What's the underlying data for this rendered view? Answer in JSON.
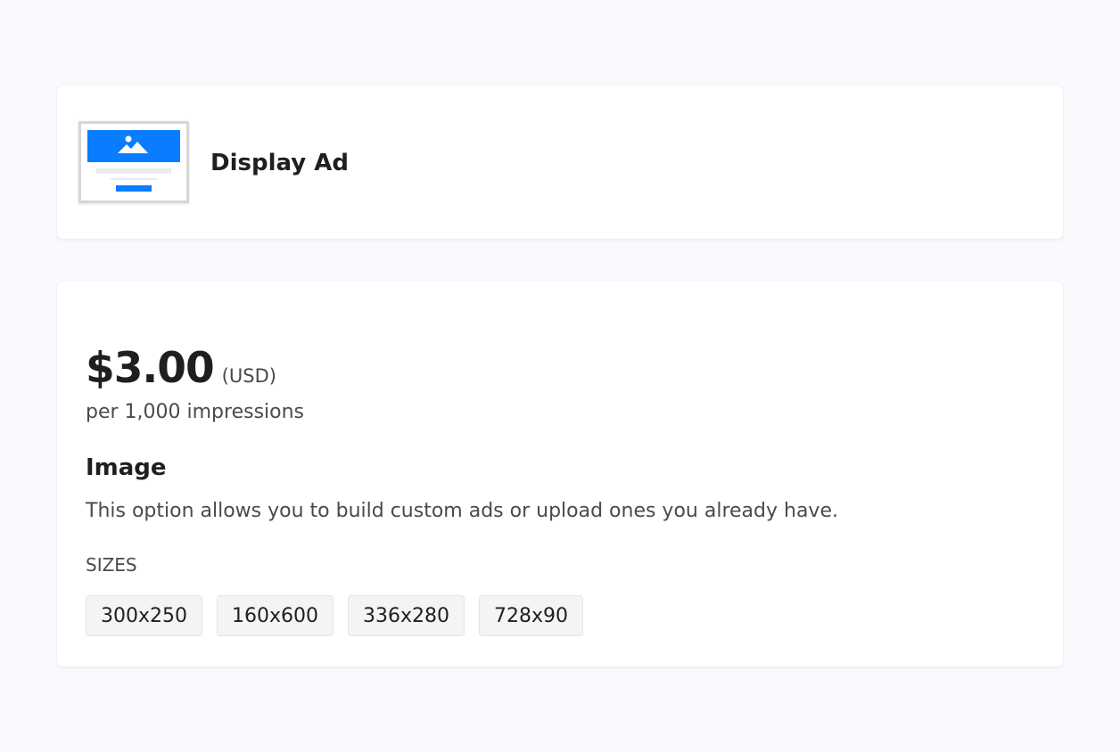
{
  "ad_type": {
    "title": "Display Ad",
    "icon": "display-ad-thumbnail-icon"
  },
  "pricing": {
    "price": "$3.00",
    "currency": "(USD)",
    "unit": "per 1,000 impressions"
  },
  "format": {
    "heading": "Image",
    "description": "This option allows you to build custom ads or upload ones you already have."
  },
  "sizes": {
    "label": "SIZES",
    "items": [
      "300x250",
      "160x600",
      "336x280",
      "728x90"
    ]
  },
  "colors": {
    "accent": "#0a7cff",
    "page_background": "#f9fafd",
    "card_background": "#ffffff",
    "chip_background": "#f4f4f4"
  }
}
